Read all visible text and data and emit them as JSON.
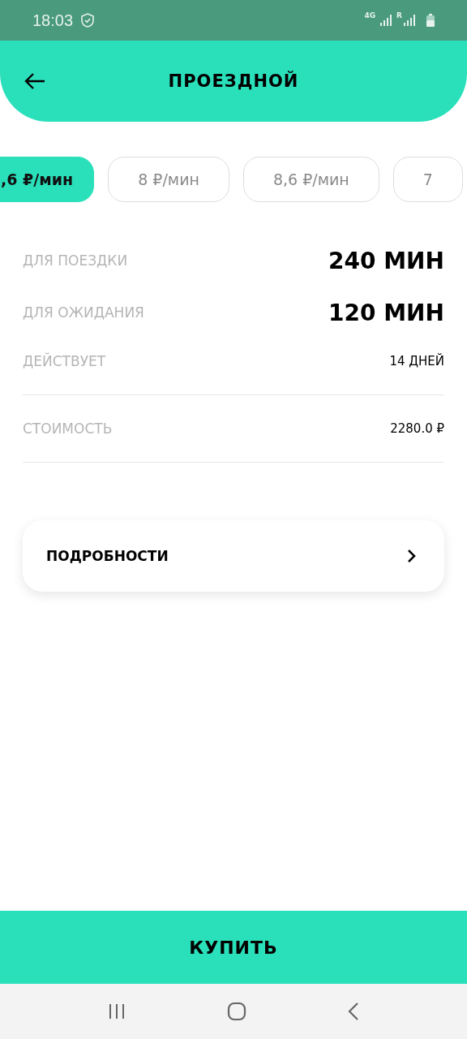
{
  "status_bar": {
    "time": "18:03",
    "network": "4G",
    "roaming": "R"
  },
  "header": {
    "title": "ПРОЕЗДНОЙ"
  },
  "tariffs": [
    {
      "label": ",6 ₽/мин",
      "selected": true
    },
    {
      "label": "8 ₽/мин",
      "selected": false
    },
    {
      "label": "8,6 ₽/мин",
      "selected": false
    },
    {
      "label": "7",
      "selected": false
    }
  ],
  "rows": [
    {
      "label": "ДЛЯ ПОЕЗДКИ",
      "value": "240 МИН",
      "kind": "large",
      "divider_after": false
    },
    {
      "label": "ДЛЯ ОЖИДАНИЯ",
      "value": "120 МИН",
      "kind": "large",
      "divider_after": false
    },
    {
      "label": "ДЕЙСТВУЕТ",
      "value": "14 ДНЕЙ",
      "kind": "small",
      "divider_after": true
    },
    {
      "label": "СТОИМОСТЬ",
      "value": "2280.0 ₽",
      "kind": "small",
      "divider_after": true
    }
  ],
  "details": {
    "label": "ПОДРОБНОСТИ"
  },
  "buy_button": {
    "label": "КУПИТЬ"
  }
}
